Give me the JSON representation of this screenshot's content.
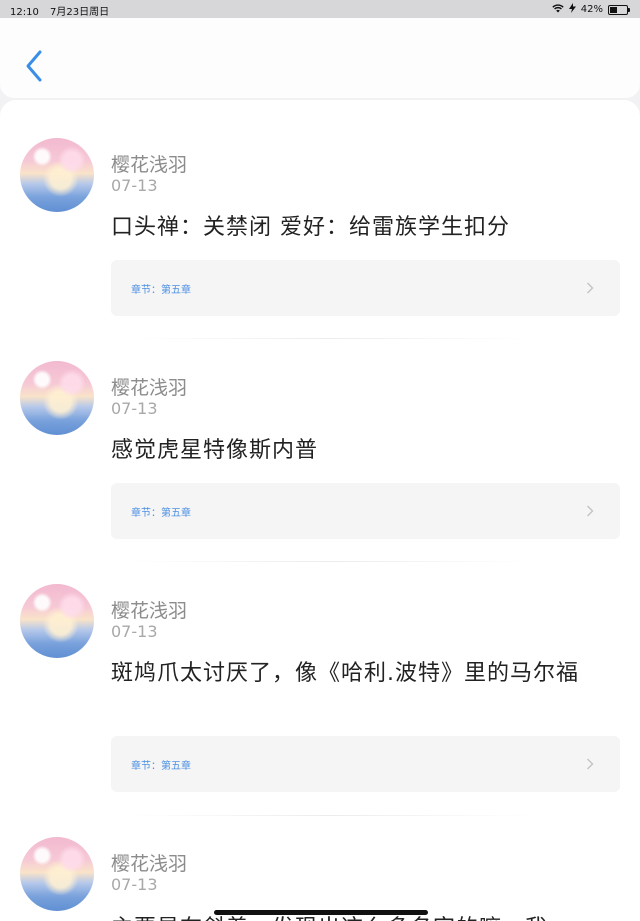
{
  "status_bar": {
    "time": "12:10",
    "date": "7月23日周日",
    "battery": "42%",
    "battery_level": 0.42
  },
  "comments": [
    {
      "username": "樱花浅羽",
      "date": "07-13",
      "content": "口头禅：关禁闭  爱好：给雷族学生扣分",
      "chapter": "章节：第五章"
    },
    {
      "username": "樱花浅羽",
      "date": "07-13",
      "content": "感觉虎星特像斯内普",
      "chapter": "章节：第五章"
    },
    {
      "username": "樱花浅羽",
      "date": "07-13",
      "content": "斑鸠爪太讨厌了，像《哈利.波特》里的马尔福",
      "chapter": "章节：第五章"
    },
    {
      "username": "樱花浅羽",
      "date": "07-13",
      "content": "主要是在斜着，发现出这么多名字的嘛，我"
    }
  ]
}
